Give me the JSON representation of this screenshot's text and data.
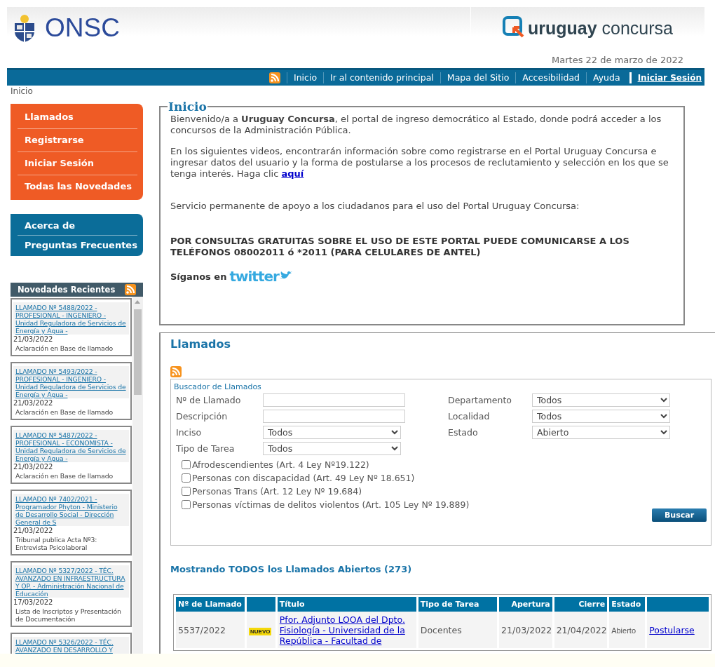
{
  "header": {
    "org_logo": "ONSC",
    "portal_logo": "**uruguay** concursa",
    "date": "Martes 22 de marzo de 2022"
  },
  "nav": {
    "items": [
      {
        "label": "Inicio",
        "kind": "link"
      },
      {
        "label": "Ir al contenido principal",
        "kind": "link"
      },
      {
        "label": "Mapa del Sitio",
        "kind": "link"
      },
      {
        "label": "Accesibilidad",
        "kind": "link"
      },
      {
        "label": "Ayuda",
        "kind": "link"
      },
      {
        "label": "Iniciar Sesión",
        "kind": "login"
      }
    ]
  },
  "breadcrumb": [
    "Inicio"
  ],
  "sidebar": {
    "main_menu": [
      "Llamados",
      "Registrarse",
      "Iniciar Sesión",
      "Todas las Novedades"
    ],
    "info_menu": [
      "Acerca de",
      "Preguntas Frecuentes"
    ],
    "news": {
      "title": "Novedades Recientes",
      "items": [
        {
          "link": "LLAMADO Nº 5488/2022 - PROFESIONAL - INGENIERO - Unidad Reguladora de Servicios de Energía y Agua -",
          "date": "21/03/2022",
          "note": "Aclaración en Base de llamado"
        },
        {
          "link": "LLAMADO Nº 5493/2022 - PROFESIONAL - INGENIERO - Unidad Reguladora de Servicios de Energía y Agua -",
          "date": "21/03/2022",
          "note": "Aclaración en Base de llamado"
        },
        {
          "link": "LLAMADO Nº 5487/2022 - PROFESIONAL - ECONOMISTA - Unidad Reguladora de Servicios de Energía y Agua -",
          "date": "21/03/2022",
          "note": "Aclaración en Base de llamado"
        },
        {
          "link": "LLAMADO Nº 7402/2021 - Programador Phyton - Ministerio de Desarrollo Social - Dirección General de S",
          "date": "21/03/2022",
          "note": "Tribunal publica Acta Nº3: Entrevista Psicolaboral"
        },
        {
          "link": "LLAMADO Nº 5327/2022 - TÉC. AVANZADO EN INFRAESTRUCTURA Y OP. - Administración Nacional de Educación",
          "date": "17/03/2022",
          "note": "Lista de Inscriptos y Presentación de Documentación"
        },
        {
          "link": "LLAMADO Nº 5326/2022 - TÉC. AVANZADO EN DESARROLLO Y"
        }
      ]
    }
  },
  "welcome": {
    "title": "Inicio",
    "paragraphs": [
      {
        "kind": "text",
        "text": "Bienvenido/a a **Uruguay Concursa**, el portal de ingreso democrático al Estado, donde podrá acceder a los concursos de la Administración Pública."
      },
      {
        "kind": "text",
        "text": "En los siguientes videos, encontrarán información sobre como registrarse en el Portal Uruguay Concursa e ingresar datos del usuario y la forma de postularse a los procesos de reclutamiento y selección en los que se tenga interés. Haga clic",
        "link": "aquí"
      },
      {
        "kind": "spaced",
        "text": "Servicio permanente de apoyo a los ciudadanos para el uso del Portal Uruguay Concursa:"
      },
      {
        "kind": "notice",
        "text": "POR CONSULTAS GRATUITAS SOBRE EL USO DE ESTE PORTAL PUEDE COMUNICARSE A LOS TELÉFONOS 08002011 ó *2011 (PARA CELULARES DE ANTEL)"
      }
    ],
    "follow": {
      "label": "Síganos en",
      "network": "twitter"
    }
  },
  "calls": {
    "title": "Llamados",
    "search": {
      "title": "Buscador de Llamados",
      "fields": [
        {
          "label": "Nº de Llamado",
          "kind": "text"
        },
        {
          "label": "Departamento",
          "kind": "select",
          "value": "Todos"
        },
        {
          "label": "Descripción",
          "kind": "text"
        },
        {
          "label": "Localidad",
          "kind": "select",
          "value": "Todos"
        },
        {
          "label": "Inciso",
          "kind": "select",
          "value": "Todos"
        },
        {
          "label": "Estado",
          "kind": "select",
          "value": "Abierto"
        },
        {
          "label": "Tipo de Tarea",
          "kind": "select",
          "value": "Todos"
        }
      ],
      "checkboxes": [
        {
          "label": "Afrodescendientes (Art. 4 Ley Nº19.122)",
          "checked": false
        },
        {
          "label": "Personas con discapacidad (Art. 49 Ley Nº 18.651)",
          "checked": false
        },
        {
          "label": "Personas Trans (Art. 12 Ley Nº 19.684)",
          "checked": false
        },
        {
          "label": "Personas víctimas de delitos violentos (Art. 105 Ley Nº 19.889)",
          "checked": false
        }
      ],
      "button": "Buscar"
    },
    "summary": "Mostrando TODOS los Llamados Abiertos (273)",
    "table": {
      "columns": [
        {
          "label": "Nº de Llamado",
          "kind": "text"
        },
        {
          "kind": "badge"
        },
        {
          "label": "Título",
          "kind": "link"
        },
        {
          "label": "Tipo de Tarea",
          "kind": "text"
        },
        {
          "label": "Apertura",
          "kind": "date"
        },
        {
          "label": "Cierre",
          "kind": "date"
        },
        {
          "label": "Estado",
          "kind": "status"
        },
        {
          "kind": "action"
        }
      ],
      "rows": [
        {
          "cells": [
            "5537/2022",
            "NUEVO",
            "Pfor. Adjunto LOOA del Dpto. Fisiología - Universidad de la República - Facultad de",
            "Docentes",
            "21/03/2022",
            "21/04/2022",
            "Abierto",
            "Postularse"
          ]
        }
      ]
    }
  }
}
